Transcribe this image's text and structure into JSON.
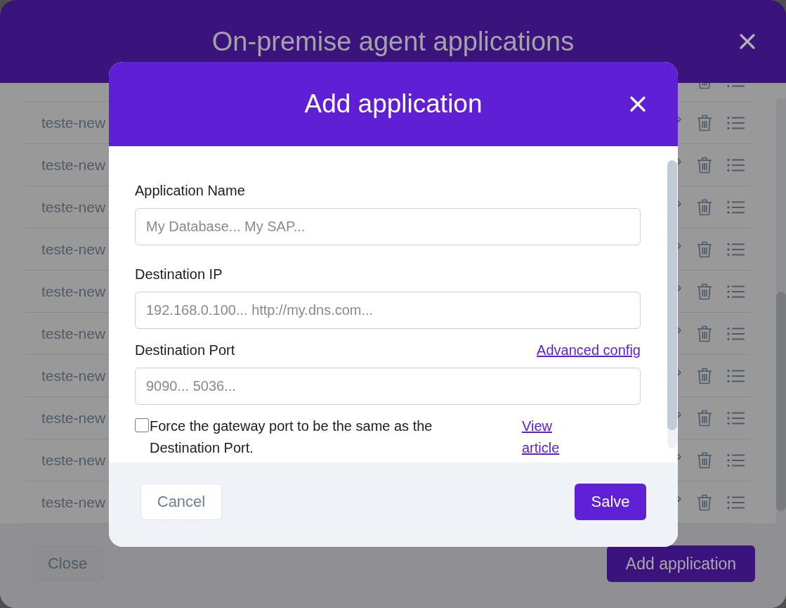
{
  "window": {
    "title": "On-premise agent applications"
  },
  "applications": [
    {
      "kind": "clipped"
    },
    {
      "kind": "row",
      "name": "teste-new"
    },
    {
      "kind": "row",
      "name": "teste-new"
    },
    {
      "kind": "row",
      "name": "teste-new"
    },
    {
      "kind": "row",
      "name": "teste-new"
    },
    {
      "kind": "row",
      "name": "teste-new"
    },
    {
      "kind": "row",
      "name": "teste-new"
    },
    {
      "kind": "row",
      "name": "teste-new"
    },
    {
      "kind": "row",
      "name": "teste-new"
    },
    {
      "kind": "row",
      "name": "teste-new"
    },
    {
      "kind": "row",
      "name": "teste-new"
    }
  ],
  "footer": {
    "buttons": [
      {
        "label": "Close",
        "kind": "secondary"
      },
      {
        "label": "Add application",
        "kind": "primary"
      }
    ]
  },
  "dialog": {
    "title": "Add application",
    "fields": [
      {
        "label": "Application Name",
        "placeholder": "My Database... My SAP..."
      },
      {
        "label": "Destination IP",
        "placeholder": "192.168.0.100... http://my.dns.com..."
      },
      {
        "label": "Destination Port",
        "placeholder": "9090... 5036...",
        "link": "Advanced config"
      }
    ],
    "option": {
      "label": "Force the gateway port to be the same as the Destination Port.",
      "checked": false,
      "link": "View article"
    },
    "buttons": [
      {
        "label": "Cancel",
        "kind": "secondary"
      },
      {
        "label": "Salve",
        "kind": "primary"
      }
    ]
  }
}
